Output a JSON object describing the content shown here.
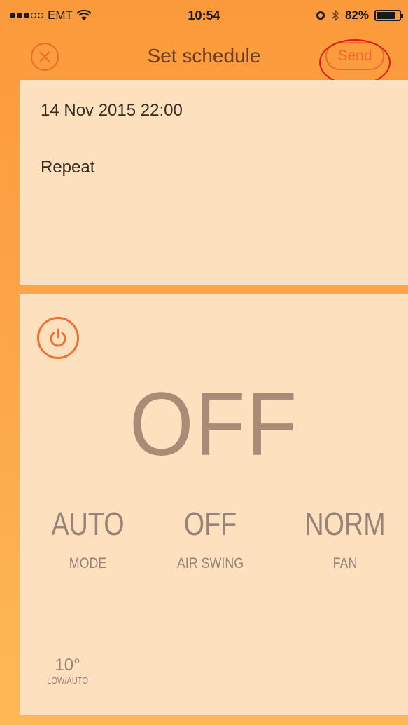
{
  "status_bar": {
    "carrier": "EMT",
    "time": "10:54",
    "battery_percent": "82%",
    "battery_level": 0.82,
    "icons": [
      "signal-dots-icon",
      "wifi-icon",
      "alarm-icon",
      "bluetooth-icon",
      "battery-icon"
    ]
  },
  "nav": {
    "title": "Set schedule",
    "send_label": "Send",
    "close_icon": "close-circle-icon"
  },
  "schedule": {
    "datetime": "14 Nov 2015 22:00",
    "repeat_label": "Repeat"
  },
  "settings": {
    "power_icon": "power-icon",
    "power_state": "OFF",
    "mode": {
      "value": "AUTO",
      "label": "MODE"
    },
    "air_swing": {
      "value": "OFF",
      "label": "AIR SWING"
    },
    "fan": {
      "value": "NORM",
      "label": "FAN"
    },
    "temperature": {
      "value": "10°",
      "label": "LOW/AUTO"
    }
  },
  "colors": {
    "accent": "#f06a2b",
    "background": "#fca548",
    "card": "#fde1bf",
    "highlight": "#e11b1b"
  }
}
